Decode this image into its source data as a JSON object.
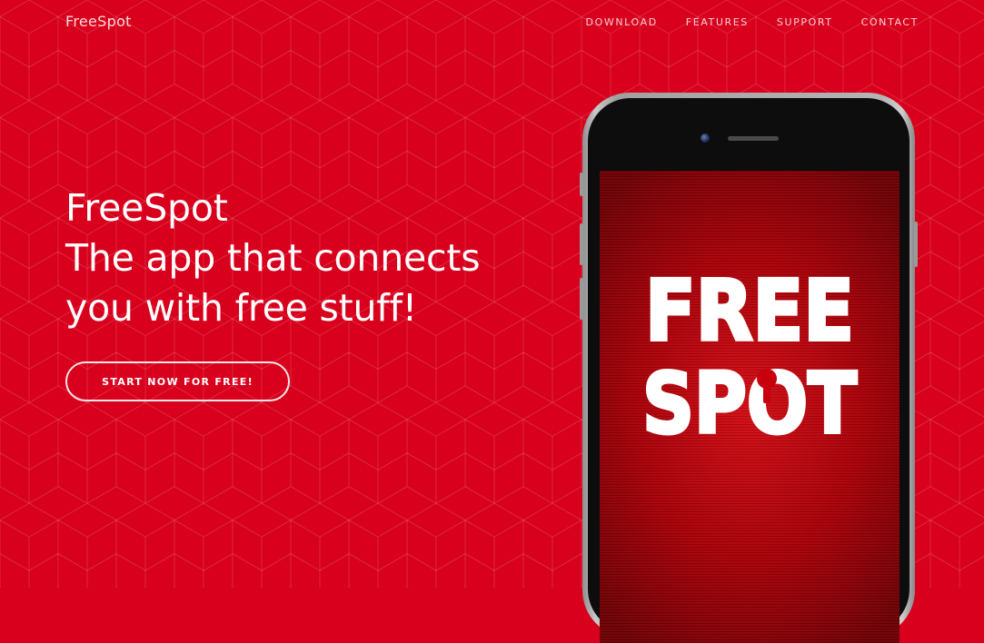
{
  "brand": {
    "name": "FreeSpot"
  },
  "nav": {
    "items": [
      {
        "label": "DOWNLOAD"
      },
      {
        "label": "FEATURES"
      },
      {
        "label": "SUPPORT"
      },
      {
        "label": "CONTACT"
      }
    ]
  },
  "hero": {
    "title_line1": "FreeSpot",
    "title_line2": "The app that connects",
    "title_line3": "you with free stuff!",
    "cta_label": "START NOW FOR FREE!"
  },
  "phone": {
    "logo_line1": "FREE",
    "logo_line2": "SPOT"
  },
  "colors": {
    "background": "#d8001c",
    "text": "#ffffff",
    "screen": "#b4000c"
  },
  "icons": {
    "keyhole": "keyhole-icon",
    "camera": "camera-icon",
    "speaker": "speaker-grille-icon"
  }
}
